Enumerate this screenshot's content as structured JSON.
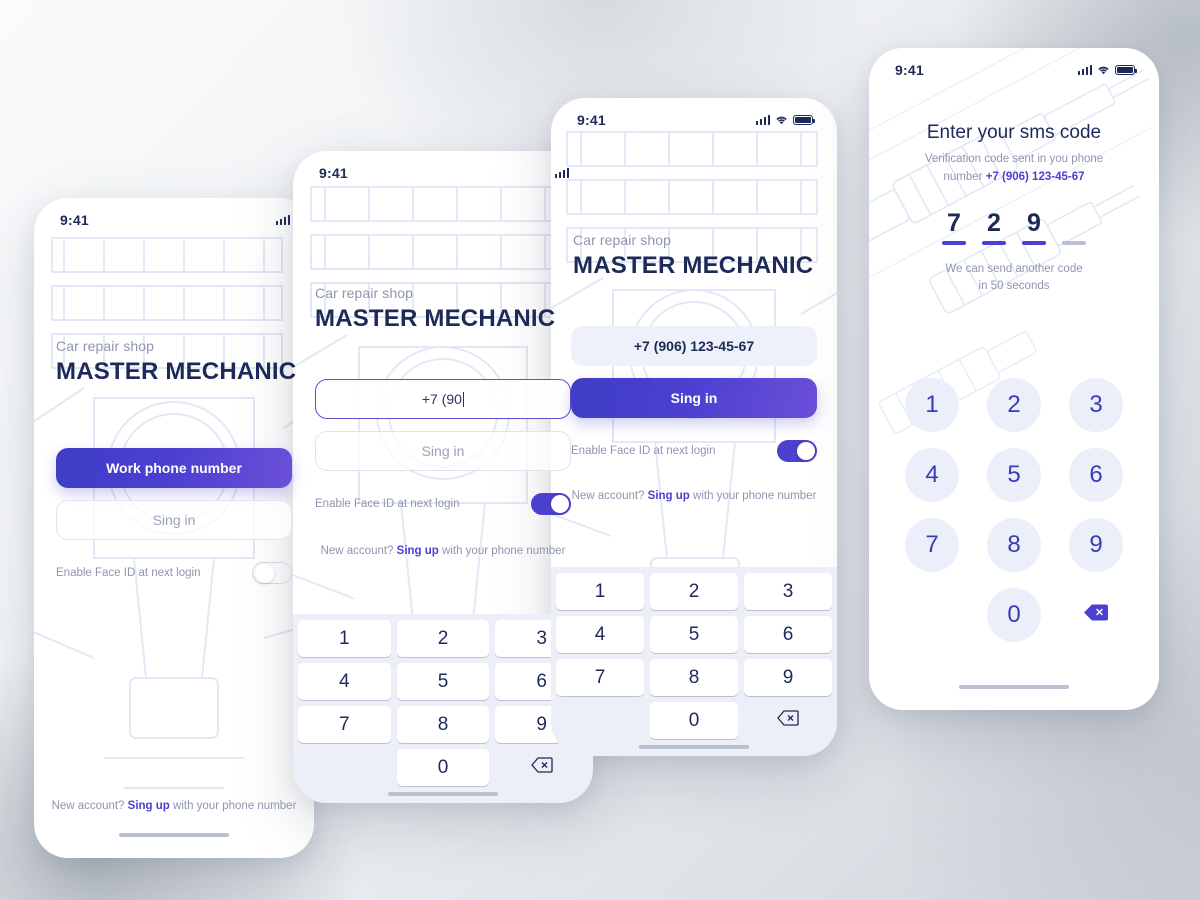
{
  "background": {
    "accent": "#4b40cf",
    "navy": "#1d2a57",
    "muted": "#8e96ad"
  },
  "status_bar": {
    "time": "9:41",
    "cellular_icon": "signal-bars-icon",
    "wifi_icon": "wifi-icon",
    "battery_icon": "battery-icon"
  },
  "brand": {
    "subtitle": "Car repair shop",
    "title": "MASTER MECHANIC"
  },
  "screens": [
    {
      "id": "screen-login-initial",
      "primary_button": "Work phone number",
      "secondary_button": "Sing in",
      "toggle_label": "Enable Face ID at next login",
      "toggle_state": "off",
      "footer_prefix": "New account? ",
      "footer_link": "Sing up",
      "footer_suffix": " with your phone number"
    },
    {
      "id": "screen-phone-typing",
      "input_value": "+7 (90",
      "secondary_button": "Sing in",
      "toggle_label": "Enable Face ID at next login",
      "toggle_state": "on",
      "footer_prefix": "New account? ",
      "footer_link": "Sing up",
      "footer_suffix": " with your phone number"
    },
    {
      "id": "screen-phone-complete",
      "input_value": "+7 (906) 123-45-67",
      "primary_button": "Sing in",
      "toggle_label": "Enable Face ID at next login",
      "toggle_state": "on",
      "footer_prefix": "New account? ",
      "footer_link": "Sing up",
      "footer_suffix": " with your phone number"
    },
    {
      "id": "screen-sms-code",
      "title": "Enter your sms code",
      "subtitle_line1": "Verification code sent in you phone",
      "subtitle_line2_prefix": "number ",
      "subtitle_phone": "+7 (906) 123-45-67",
      "code_digits": [
        "7",
        "2",
        "9",
        ""
      ],
      "timer_line1": "We can send another code",
      "timer_line2": "in 50 seconds"
    }
  ],
  "keypad": {
    "rows": [
      [
        "1",
        "2",
        "3"
      ],
      [
        "4",
        "5",
        "6"
      ],
      [
        "7",
        "8",
        "9"
      ]
    ],
    "zero": "0",
    "backspace_icon": "backspace-icon"
  }
}
